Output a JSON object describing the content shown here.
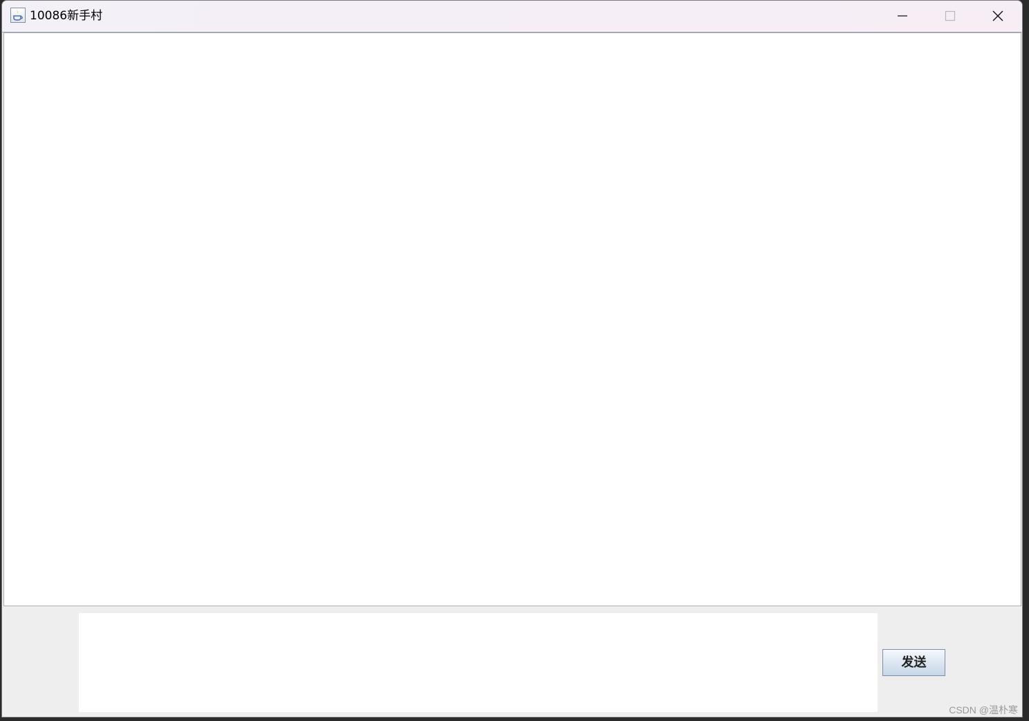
{
  "window": {
    "title": "10086新手村",
    "controls": {
      "minimize_icon": "minimize-icon",
      "maximize_icon": "maximize-icon",
      "close_icon": "close-icon"
    }
  },
  "chat": {
    "message_area_value": "",
    "input_value": "",
    "send_label": "发送"
  },
  "watermark": "CSDN @温朴寒",
  "colors": {
    "titlebar": "#f4eff7",
    "panel": "#eeeeee",
    "button_top": "#f6f9fc",
    "button_bottom": "#c6d6e8"
  }
}
